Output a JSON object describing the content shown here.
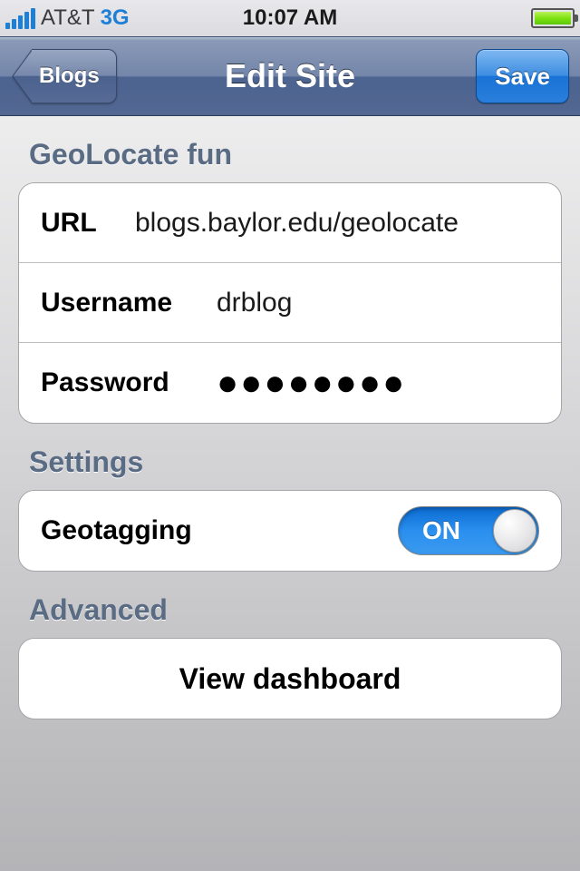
{
  "status": {
    "carrier": "AT&T",
    "connection": "3G",
    "time": "10:07 AM"
  },
  "nav": {
    "back_label": "Blogs",
    "title": "Edit Site",
    "save_label": "Save"
  },
  "sections": {
    "site": {
      "header": "GeoLocate fun",
      "url_label": "URL",
      "url_value": "blogs.baylor.edu/geolocate",
      "username_label": "Username",
      "username_value": "drblog",
      "password_label": "Password",
      "password_masked": "●●●●●●●●"
    },
    "settings": {
      "header": "Settings",
      "geotagging_label": "Geotagging",
      "toggle_state": "ON"
    },
    "advanced": {
      "header": "Advanced",
      "view_dashboard_label": "View dashboard"
    }
  }
}
